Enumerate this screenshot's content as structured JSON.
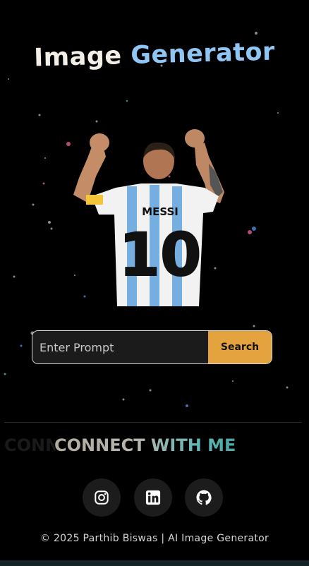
{
  "header": {
    "title_word1": "Image",
    "title_word2": "Generator"
  },
  "hero": {
    "jersey_name": "MESSI",
    "jersey_number": "10"
  },
  "search": {
    "placeholder": "Enter Prompt",
    "button_label": "Search"
  },
  "connect": {
    "ghost_text": "CONNECT WITH ME",
    "heading": "CONNECT WITH ME"
  },
  "social": [
    {
      "icon": "instagram-icon"
    },
    {
      "icon": "linkedin-icon"
    },
    {
      "icon": "github-icon"
    }
  ],
  "footer": {
    "copyright": "© 2025 Parthib Biswas | AI Image Generator"
  },
  "colors": {
    "background": "#000000",
    "accent": "#e4a33e",
    "title_blue": "#8fc6f4",
    "heading_teal": "#49a6a4"
  }
}
